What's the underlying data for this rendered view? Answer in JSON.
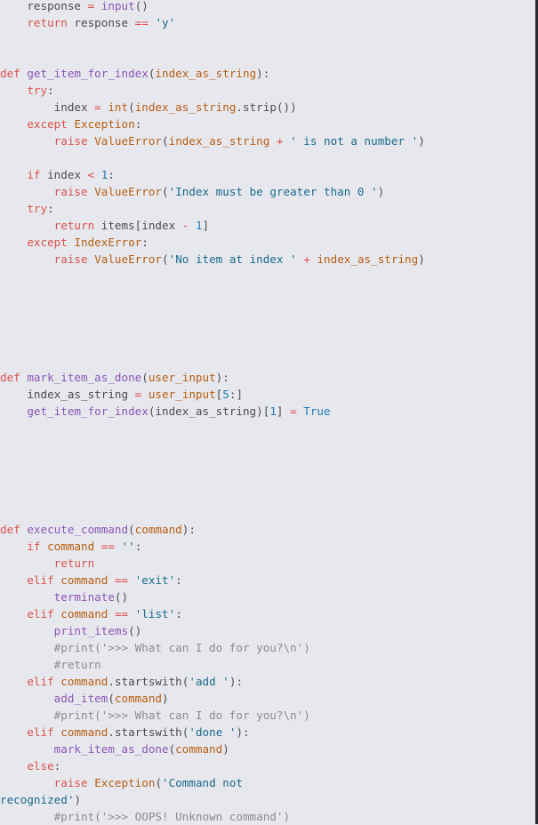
{
  "editor": {
    "language": "python",
    "lines": [
      [
        {
          "t": "    ",
          "k": "plain"
        },
        {
          "t": "response",
          "k": "plain"
        },
        {
          "t": " ",
          "k": "plain"
        },
        {
          "t": "=",
          "k": "op"
        },
        {
          "t": " ",
          "k": "plain"
        },
        {
          "t": "input",
          "k": "func"
        },
        {
          "t": "()",
          "k": "plain"
        }
      ],
      [
        {
          "t": "    ",
          "k": "plain"
        },
        {
          "t": "return",
          "k": "keyword"
        },
        {
          "t": " response ",
          "k": "plain"
        },
        {
          "t": "==",
          "k": "op"
        },
        {
          "t": " ",
          "k": "plain"
        },
        {
          "t": "'y'",
          "k": "string"
        }
      ],
      [],
      [],
      [
        {
          "t": "def",
          "k": "keyword"
        },
        {
          "t": " ",
          "k": "plain"
        },
        {
          "t": "get_item_for_index",
          "k": "func"
        },
        {
          "t": "(",
          "k": "plain"
        },
        {
          "t": "index_as_string",
          "k": "name"
        },
        {
          "t": "):",
          "k": "plain"
        }
      ],
      [
        {
          "t": "    ",
          "k": "plain"
        },
        {
          "t": "try",
          "k": "keyword"
        },
        {
          "t": ":",
          "k": "plain"
        }
      ],
      [
        {
          "t": "        index ",
          "k": "plain"
        },
        {
          "t": "=",
          "k": "op"
        },
        {
          "t": " ",
          "k": "plain"
        },
        {
          "t": "int",
          "k": "name"
        },
        {
          "t": "(",
          "k": "plain"
        },
        {
          "t": "index_as_string",
          "k": "name"
        },
        {
          "t": ".strip())",
          "k": "plain"
        }
      ],
      [
        {
          "t": "    ",
          "k": "plain"
        },
        {
          "t": "except",
          "k": "keyword"
        },
        {
          "t": " ",
          "k": "plain"
        },
        {
          "t": "Exception",
          "k": "name"
        },
        {
          "t": ":",
          "k": "plain"
        }
      ],
      [
        {
          "t": "        ",
          "k": "plain"
        },
        {
          "t": "raise",
          "k": "keyword"
        },
        {
          "t": " ",
          "k": "plain"
        },
        {
          "t": "ValueError",
          "k": "name"
        },
        {
          "t": "(",
          "k": "plain"
        },
        {
          "t": "index_as_string",
          "k": "name"
        },
        {
          "t": " ",
          "k": "plain"
        },
        {
          "t": "+",
          "k": "op"
        },
        {
          "t": " ",
          "k": "plain"
        },
        {
          "t": "' is not a number '",
          "k": "string"
        },
        {
          "t": ")",
          "k": "plain"
        }
      ],
      [],
      [
        {
          "t": "    ",
          "k": "plain"
        },
        {
          "t": "if",
          "k": "keyword"
        },
        {
          "t": " index ",
          "k": "plain"
        },
        {
          "t": "<",
          "k": "op"
        },
        {
          "t": " ",
          "k": "plain"
        },
        {
          "t": "1",
          "k": "number"
        },
        {
          "t": ":",
          "k": "plain"
        }
      ],
      [
        {
          "t": "        ",
          "k": "plain"
        },
        {
          "t": "raise",
          "k": "keyword"
        },
        {
          "t": " ",
          "k": "plain"
        },
        {
          "t": "ValueError",
          "k": "name"
        },
        {
          "t": "(",
          "k": "plain"
        },
        {
          "t": "'Index must be greater than 0 '",
          "k": "string"
        },
        {
          "t": ")",
          "k": "plain"
        }
      ],
      [
        {
          "t": "    ",
          "k": "plain"
        },
        {
          "t": "try",
          "k": "keyword"
        },
        {
          "t": ":",
          "k": "plain"
        }
      ],
      [
        {
          "t": "        ",
          "k": "plain"
        },
        {
          "t": "return",
          "k": "keyword"
        },
        {
          "t": " items[index ",
          "k": "plain"
        },
        {
          "t": "-",
          "k": "op"
        },
        {
          "t": " ",
          "k": "plain"
        },
        {
          "t": "1",
          "k": "number"
        },
        {
          "t": "]",
          "k": "plain"
        }
      ],
      [
        {
          "t": "    ",
          "k": "plain"
        },
        {
          "t": "except",
          "k": "keyword"
        },
        {
          "t": " ",
          "k": "plain"
        },
        {
          "t": "IndexError",
          "k": "name"
        },
        {
          "t": ":",
          "k": "plain"
        }
      ],
      [
        {
          "t": "        ",
          "k": "plain"
        },
        {
          "t": "raise",
          "k": "keyword"
        },
        {
          "t": " ",
          "k": "plain"
        },
        {
          "t": "ValueError",
          "k": "name"
        },
        {
          "t": "(",
          "k": "plain"
        },
        {
          "t": "'No item at index '",
          "k": "string"
        },
        {
          "t": " ",
          "k": "plain"
        },
        {
          "t": "+",
          "k": "op"
        },
        {
          "t": " ",
          "k": "plain"
        },
        {
          "t": "index_as_string",
          "k": "name"
        },
        {
          "t": ")",
          "k": "plain"
        }
      ],
      [],
      [],
      [],
      [],
      [],
      [],
      [
        {
          "t": "def",
          "k": "keyword"
        },
        {
          "t": " ",
          "k": "plain"
        },
        {
          "t": "mark_item_as_done",
          "k": "func"
        },
        {
          "t": "(",
          "k": "plain"
        },
        {
          "t": "user_input",
          "k": "name"
        },
        {
          "t": "):",
          "k": "plain"
        }
      ],
      [
        {
          "t": "    index_as_string ",
          "k": "plain"
        },
        {
          "t": "=",
          "k": "op"
        },
        {
          "t": " ",
          "k": "plain"
        },
        {
          "t": "user_input",
          "k": "name"
        },
        {
          "t": "[",
          "k": "plain"
        },
        {
          "t": "5",
          "k": "number"
        },
        {
          "t": ":]",
          "k": "plain"
        }
      ],
      [
        {
          "t": "    ",
          "k": "plain"
        },
        {
          "t": "get_item_for_index",
          "k": "func"
        },
        {
          "t": "(index_as_string)[",
          "k": "plain"
        },
        {
          "t": "1",
          "k": "number"
        },
        {
          "t": "] ",
          "k": "plain"
        },
        {
          "t": "=",
          "k": "op"
        },
        {
          "t": " ",
          "k": "plain"
        },
        {
          "t": "True",
          "k": "const"
        }
      ],
      [],
      [],
      [],
      [],
      [],
      [],
      [
        {
          "t": "def",
          "k": "keyword"
        },
        {
          "t": " ",
          "k": "plain"
        },
        {
          "t": "execute_command",
          "k": "func"
        },
        {
          "t": "(",
          "k": "plain"
        },
        {
          "t": "command",
          "k": "name"
        },
        {
          "t": "):",
          "k": "plain"
        }
      ],
      [
        {
          "t": "    ",
          "k": "plain"
        },
        {
          "t": "if",
          "k": "keyword"
        },
        {
          "t": " ",
          "k": "plain"
        },
        {
          "t": "command",
          "k": "name"
        },
        {
          "t": " ",
          "k": "plain"
        },
        {
          "t": "==",
          "k": "op"
        },
        {
          "t": " ",
          "k": "plain"
        },
        {
          "t": "''",
          "k": "string"
        },
        {
          "t": ":",
          "k": "plain"
        }
      ],
      [
        {
          "t": "        ",
          "k": "plain"
        },
        {
          "t": "return",
          "k": "keyword"
        }
      ],
      [
        {
          "t": "    ",
          "k": "plain"
        },
        {
          "t": "elif",
          "k": "keyword"
        },
        {
          "t": " ",
          "k": "plain"
        },
        {
          "t": "command",
          "k": "name"
        },
        {
          "t": " ",
          "k": "plain"
        },
        {
          "t": "==",
          "k": "op"
        },
        {
          "t": " ",
          "k": "plain"
        },
        {
          "t": "'exit'",
          "k": "string"
        },
        {
          "t": ":",
          "k": "plain"
        }
      ],
      [
        {
          "t": "        ",
          "k": "plain"
        },
        {
          "t": "terminate",
          "k": "func"
        },
        {
          "t": "()",
          "k": "plain"
        }
      ],
      [
        {
          "t": "    ",
          "k": "plain"
        },
        {
          "t": "elif",
          "k": "keyword"
        },
        {
          "t": " ",
          "k": "plain"
        },
        {
          "t": "command",
          "k": "name"
        },
        {
          "t": " ",
          "k": "plain"
        },
        {
          "t": "==",
          "k": "op"
        },
        {
          "t": " ",
          "k": "plain"
        },
        {
          "t": "'list'",
          "k": "string"
        },
        {
          "t": ":",
          "k": "plain"
        }
      ],
      [
        {
          "t": "        ",
          "k": "plain"
        },
        {
          "t": "print_items",
          "k": "func"
        },
        {
          "t": "()",
          "k": "plain"
        }
      ],
      [
        {
          "t": "        ",
          "k": "plain"
        },
        {
          "t": "#print('>>> What can I do for you?\\n')",
          "k": "comment"
        }
      ],
      [
        {
          "t": "        ",
          "k": "plain"
        },
        {
          "t": "#return",
          "k": "comment"
        }
      ],
      [
        {
          "t": "    ",
          "k": "plain"
        },
        {
          "t": "elif",
          "k": "keyword"
        },
        {
          "t": " ",
          "k": "plain"
        },
        {
          "t": "command",
          "k": "name"
        },
        {
          "t": ".startswith(",
          "k": "plain"
        },
        {
          "t": "'add '",
          "k": "string"
        },
        {
          "t": "):",
          "k": "plain"
        }
      ],
      [
        {
          "t": "        ",
          "k": "plain"
        },
        {
          "t": "add_item",
          "k": "func"
        },
        {
          "t": "(",
          "k": "plain"
        },
        {
          "t": "command",
          "k": "name"
        },
        {
          "t": ")",
          "k": "plain"
        }
      ],
      [
        {
          "t": "        ",
          "k": "plain"
        },
        {
          "t": "#print('>>> What can I do for you?\\n')",
          "k": "comment"
        }
      ],
      [
        {
          "t": "    ",
          "k": "plain"
        },
        {
          "t": "elif",
          "k": "keyword"
        },
        {
          "t": " ",
          "k": "plain"
        },
        {
          "t": "command",
          "k": "name"
        },
        {
          "t": ".startswith(",
          "k": "plain"
        },
        {
          "t": "'done '",
          "k": "string"
        },
        {
          "t": "):",
          "k": "plain"
        }
      ],
      [
        {
          "t": "        ",
          "k": "plain"
        },
        {
          "t": "mark_item_as_done",
          "k": "func"
        },
        {
          "t": "(",
          "k": "plain"
        },
        {
          "t": "command",
          "k": "name"
        },
        {
          "t": ")",
          "k": "plain"
        }
      ],
      [
        {
          "t": "    ",
          "k": "plain"
        },
        {
          "t": "else",
          "k": "keyword"
        },
        {
          "t": ":",
          "k": "plain"
        }
      ],
      [
        {
          "t": "        ",
          "k": "plain"
        },
        {
          "t": "raise",
          "k": "keyword"
        },
        {
          "t": " ",
          "k": "plain"
        },
        {
          "t": "Exception",
          "k": "name"
        },
        {
          "t": "(",
          "k": "plain"
        },
        {
          "t": "'Command not",
          "k": "string"
        }
      ],
      [
        {
          "t": "recognized'",
          "k": "string"
        },
        {
          "t": ")",
          "k": "plain"
        }
      ],
      [
        {
          "t": "        ",
          "k": "plain"
        },
        {
          "t": "#print('>>> OOPS! Unknown command')",
          "k": "comment"
        }
      ]
    ]
  }
}
